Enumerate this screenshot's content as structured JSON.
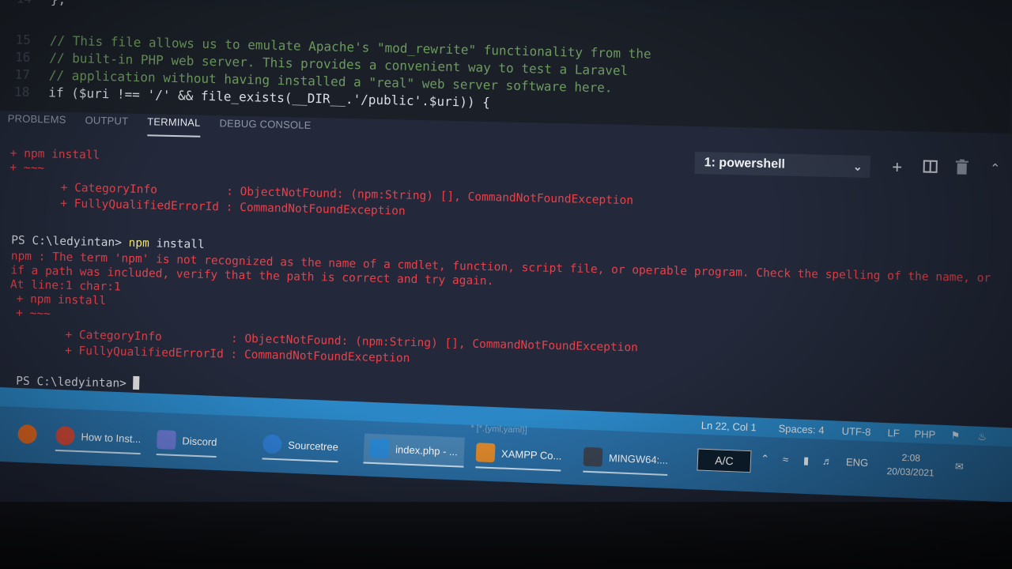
{
  "editor": {
    "lines": [
      {
        "no": "14",
        "text": "};",
        "kind": "code"
      },
      {
        "no": "15",
        "text": "// This file allows us to emulate Apache's \"mod_rewrite\" functionality from the",
        "kind": "comment"
      },
      {
        "no": "16",
        "text": "// built-in PHP web server. This provides a convenient way to test a Laravel",
        "kind": "comment"
      },
      {
        "no": "17",
        "text": "// application without having installed a \"real\" web server software here.",
        "kind": "comment"
      },
      {
        "no": "18",
        "text": "if ($uri !== '/' && file_exists(__DIR__.'/public'.$uri)) {",
        "kind": "code"
      }
    ]
  },
  "panel": {
    "tabs": [
      "PROBLEMS",
      "OUTPUT",
      "TERMINAL",
      "DEBUG CONSOLE"
    ],
    "active_tab": "TERMINAL",
    "terminal_selector": "1: powershell"
  },
  "terminal": {
    "lines": [
      {
        "text": "+ npm install",
        "kind": "err"
      },
      {
        "text": "+ ~~~",
        "kind": "err"
      },
      {
        "text": "    + CategoryInfo          : ObjectNotFound: (npm:String) [], CommandNotFoundException",
        "kind": "err"
      },
      {
        "text": "    + FullyQualifiedErrorId : CommandNotFoundException",
        "kind": "err"
      },
      {
        "text": "",
        "kind": "blank"
      },
      {
        "prompt": "PS C:\\ledyintan> ",
        "cmd": "npm",
        "args": " install",
        "kind": "cmd"
      },
      {
        "text": "npm : The term 'npm' is not recognized as the name of a cmdlet, function, script file, or operable program. Check the spelling of the name, or",
        "kind": "err"
      },
      {
        "text": "if a path was included, verify that the path is correct and try again.",
        "kind": "err"
      },
      {
        "text": "At line:1 char:1",
        "kind": "err"
      },
      {
        "text": "+ npm install",
        "kind": "err"
      },
      {
        "text": "+ ~~~",
        "kind": "err"
      },
      {
        "text": "    + CategoryInfo          : ObjectNotFound: (npm:String) [], CommandNotFoundException",
        "kind": "err"
      },
      {
        "text": "    + FullyQualifiedErrorId : CommandNotFoundException",
        "kind": "err"
      },
      {
        "text": "",
        "kind": "blank"
      },
      {
        "prompt": "PS C:\\ledyintan> ",
        "kind": "prompt"
      }
    ]
  },
  "statusbar": {
    "position": "Ln 22, Col 1",
    "spaces": "Spaces: 4",
    "encoding": "UTF-8",
    "eol": "LF",
    "language": "PHP"
  },
  "taskbar": {
    "apps": [
      {
        "label": "",
        "icon": "firefox-icon",
        "color": "#e66a22"
      },
      {
        "label": "How to Inst...",
        "icon": "chrome-icon",
        "color": "#d24a3a"
      },
      {
        "label": "Discord",
        "icon": "discord-icon",
        "color": "#6b7bd6"
      },
      {
        "label": "Sourcetree",
        "icon": "sourcetree-icon",
        "color": "#2f7fd6"
      },
      {
        "label": "index.php - ...",
        "icon": "vscode-icon",
        "color": "#2a8ad8"
      },
      {
        "label": "XAMPP Co...",
        "icon": "xampp-icon",
        "color": "#e08a2c"
      },
      {
        "label": "MINGW64:...",
        "icon": "terminal-icon",
        "color": "#3b4452"
      }
    ],
    "tooltip_fragment": "* [*.{yml,yaml}]",
    "ac_label": "A/C",
    "language": "ENG",
    "time": "2:08",
    "date": "20/03/2021"
  }
}
